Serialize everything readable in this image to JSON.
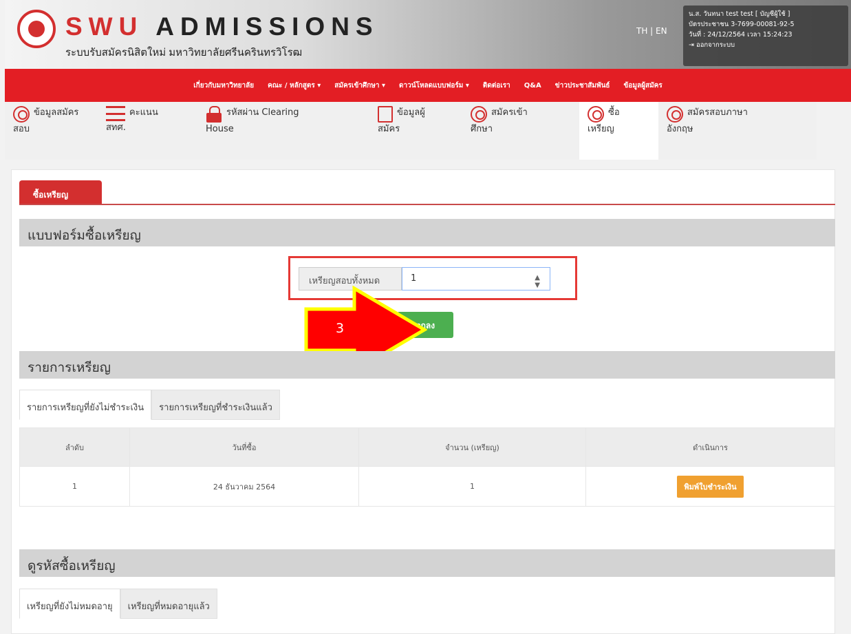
{
  "header": {
    "brand_swu": "SWU",
    "brand_admissions": "ADMISSIONS",
    "subtitle": "ระบบรับสมัครนิสิตใหม่ มหาวิทยาลัยศรีนครินทรวิโรฒ",
    "lang": "TH | EN",
    "user_line1": "น.ส. วันทนา test test [ บัญชีผู้ใช้ ]",
    "user_line2": "บัตรประชาชน 3-7699-00081-92-5",
    "user_line3": "วันที่ : 24/12/2564 เวลา 15:24:23",
    "user_logout": "ออกจากระบบ"
  },
  "nav": {
    "items": [
      "เกี่ยวกับมหาวิทยาลัย",
      "คณะ / หลักสูตร ▾",
      "สมัครเข้าศึกษา ▾",
      "ดาวน์โหลดแบบฟอร์ม ▾",
      "ติดต่อเรา",
      "Q&A",
      "ข่าวประชาสัมพันธ์",
      "ข้อมูลผู้สมัคร"
    ]
  },
  "tabs": [
    {
      "line1": "ข้อมูลสมัคร",
      "line2": "สอบ"
    },
    {
      "line1": "คะแนน",
      "line2": "สทศ."
    },
    {
      "line1": "รหัสผ่าน Clearing",
      "line2": "House"
    },
    {
      "line1": "ข้อมูลผู้",
      "line2": "สมัคร"
    },
    {
      "line1": "สมัครเข้า",
      "line2": "ศึกษา"
    },
    {
      "line1": "ซื้อ",
      "line2": "เหรียญ"
    },
    {
      "line1": "สมัครสอบภาษา",
      "line2": "อังกฤษ"
    }
  ],
  "page_tab": "ซื้อเหรียญ",
  "form": {
    "section_title": "แบบฟอร์มซื้อเหรียญ",
    "label": "เหรียญสอบทั้งหมด",
    "value": "1",
    "ok": "ตกลง",
    "step": "3"
  },
  "coins": {
    "section_title": "รายการเหรียญ",
    "tab_unpaid": "รายการเหรียญที่ยังไม่ชำระเงิน",
    "tab_paid": "รายการเหรียญที่ชำระเงินแล้ว",
    "columns": [
      "ลำดับ",
      "วันที่ซื้อ",
      "จำนวน (เหรียญ)",
      "ดำเนินการ"
    ],
    "rows": [
      {
        "no": "1",
        "date": "24 ธันวาคม 2564",
        "qty": "1",
        "action": "พิมพ์ใบชำระเงิน"
      }
    ]
  },
  "codes": {
    "section_title": "ดูรหัสซื้อเหรียญ",
    "tab_valid": "เหรียญที่ยังไม่หมดอายุ",
    "tab_expired": "เหรียญที่หมดอายุแล้ว"
  },
  "colors": {
    "brand_red": "#e31e24",
    "ok_green": "#4caf50",
    "pay_orange": "#f0a030",
    "arrow_red": "#ff0000",
    "arrow_outline": "#ffff00"
  }
}
